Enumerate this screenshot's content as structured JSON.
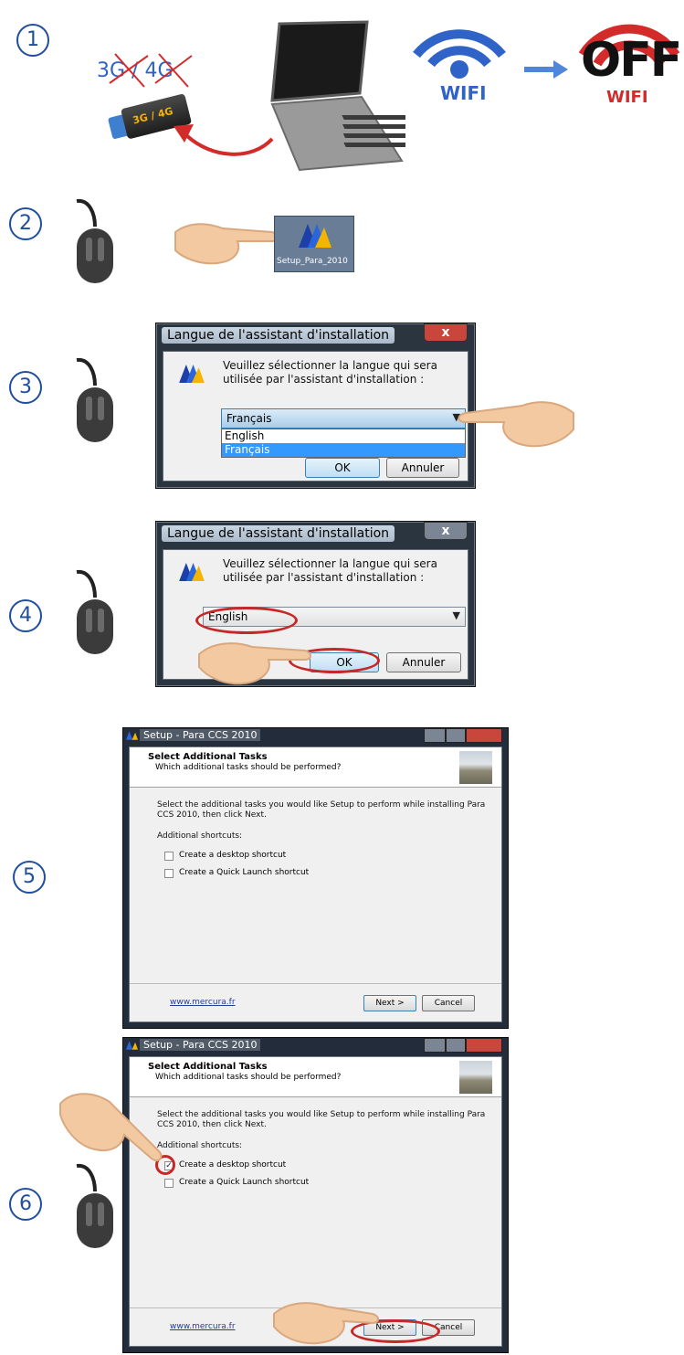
{
  "steps": [
    "1",
    "2",
    "3",
    "4",
    "5",
    "6"
  ],
  "step1": {
    "crossed_label": "3G / 4G",
    "stick_label": "3G / 4G",
    "wifi_label": "WIFI",
    "off_label": "OFF",
    "off_wifi_label": "WIFI"
  },
  "step2": {
    "desktop_icon_label": "Setup_Para_2010"
  },
  "lang_dialog": {
    "title": "Langue de l'assistant d'installation",
    "close": "x",
    "message": "Veuillez sélectionner la langue qui sera utilisée par l'assistant d'installation :",
    "ok": "OK",
    "cancel": "Annuler"
  },
  "step3": {
    "selected_language": "Français",
    "options": [
      "English",
      "Français"
    ],
    "highlighted_option": "Français"
  },
  "step4": {
    "selected_language": "English"
  },
  "wizard": {
    "title": "Setup - Para CCS 2010",
    "header_title": "Select Additional Tasks",
    "header_subtitle": "Which additional tasks should be performed?",
    "intro": "Select the additional tasks you would like Setup to perform while installing Para CCS 2010, then click Next.",
    "group_label": "Additional shortcuts:",
    "tasks": [
      "Create a desktop shortcut",
      "Create a Quick Launch shortcut"
    ],
    "link": "www.mercura.fr",
    "next": "Next >",
    "cancel": "Cancel"
  },
  "step5": {
    "checked": [
      false,
      false
    ]
  },
  "step6": {
    "checked": [
      true,
      false
    ]
  },
  "colors": {
    "step_blue": "#1f4e9e",
    "wifi_blue": "#2f63c7",
    "off_red": "#d32a2a",
    "highlight_red": "#c62828",
    "close_red": "#c9463d",
    "close_gray": "#7b8593",
    "selection_blue": "#3399ff"
  }
}
